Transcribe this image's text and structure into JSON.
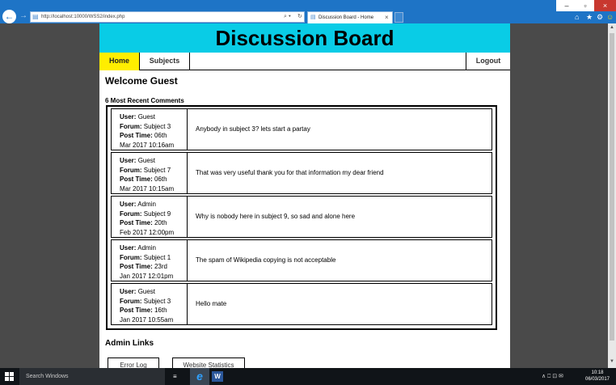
{
  "browser": {
    "url": "http://localhost:10000/WSS2/index.php",
    "tab_title": "Discussion Board - Home",
    "search_glyph": "⌕ ▾",
    "refresh_glyph": "↻",
    "back_glyph": "←",
    "forward_glyph": "→",
    "tab_close": "×",
    "minimize": "–",
    "maximize": "▫",
    "close": "×",
    "home_glyph": "⌂",
    "star_glyph": "★",
    "gear_glyph": "⚙",
    "smiley_glyph": "☺",
    "icons": [
      "back-icon",
      "forward-icon",
      "page-icon",
      "search-icon",
      "refresh-icon",
      "home-icon",
      "star-icon",
      "gear-icon",
      "smiley-icon"
    ]
  },
  "site": {
    "title": "Discussion Board",
    "nav": {
      "home": "Home",
      "subjects": "Subjects",
      "logout": "Logout"
    },
    "welcome": "Welcome Guest",
    "recent_heading": "6 Most Recent Comments",
    "labels": {
      "user": "User:",
      "forum": "Forum:",
      "post_time": "Post Time:"
    },
    "comments": [
      {
        "user": "Guest",
        "forum": "Subject 3",
        "post_time_a": "06th",
        "post_time_b": "Mar 2017 10:16am",
        "text": "Anybody in subject 3? lets start a partay"
      },
      {
        "user": "Guest",
        "forum": "Subject 7",
        "post_time_a": "06th",
        "post_time_b": "Mar 2017 10:15am",
        "text": "That was very useful thank you for that information my dear friend"
      },
      {
        "user": "Admin",
        "forum": "Subject 9",
        "post_time_a": "20th",
        "post_time_b": "Feb 2017 12:00pm",
        "text": "Why is nobody here in subject 9, so sad and alone here"
      },
      {
        "user": "Admin",
        "forum": "Subject 1",
        "post_time_a": "23rd",
        "post_time_b": "Jan 2017 12:01pm",
        "text": "The spam of Wikipedia copying is not acceptable"
      },
      {
        "user": "Guest",
        "forum": "Subject 3",
        "post_time_a": "16th",
        "post_time_b": "Jan 2017 10:55am",
        "text": "Hello mate"
      }
    ],
    "admin_heading": "Admin Links",
    "admin_buttons": {
      "error_log": "Error Log",
      "stats": "Website Statistics"
    },
    "colors": {
      "header_bg": "#09cce6",
      "active_nav": "#ffee00",
      "browser_chrome": "#1e74c6"
    }
  },
  "taskbar": {
    "search_placeholder": "Search Windows",
    "word_glyph": "W",
    "ie_glyph": "e",
    "taskview_glyph": "≡",
    "tray": "∧  ⎕  ⊡  ✉",
    "time": "10:18",
    "date": "06/03/2017"
  }
}
